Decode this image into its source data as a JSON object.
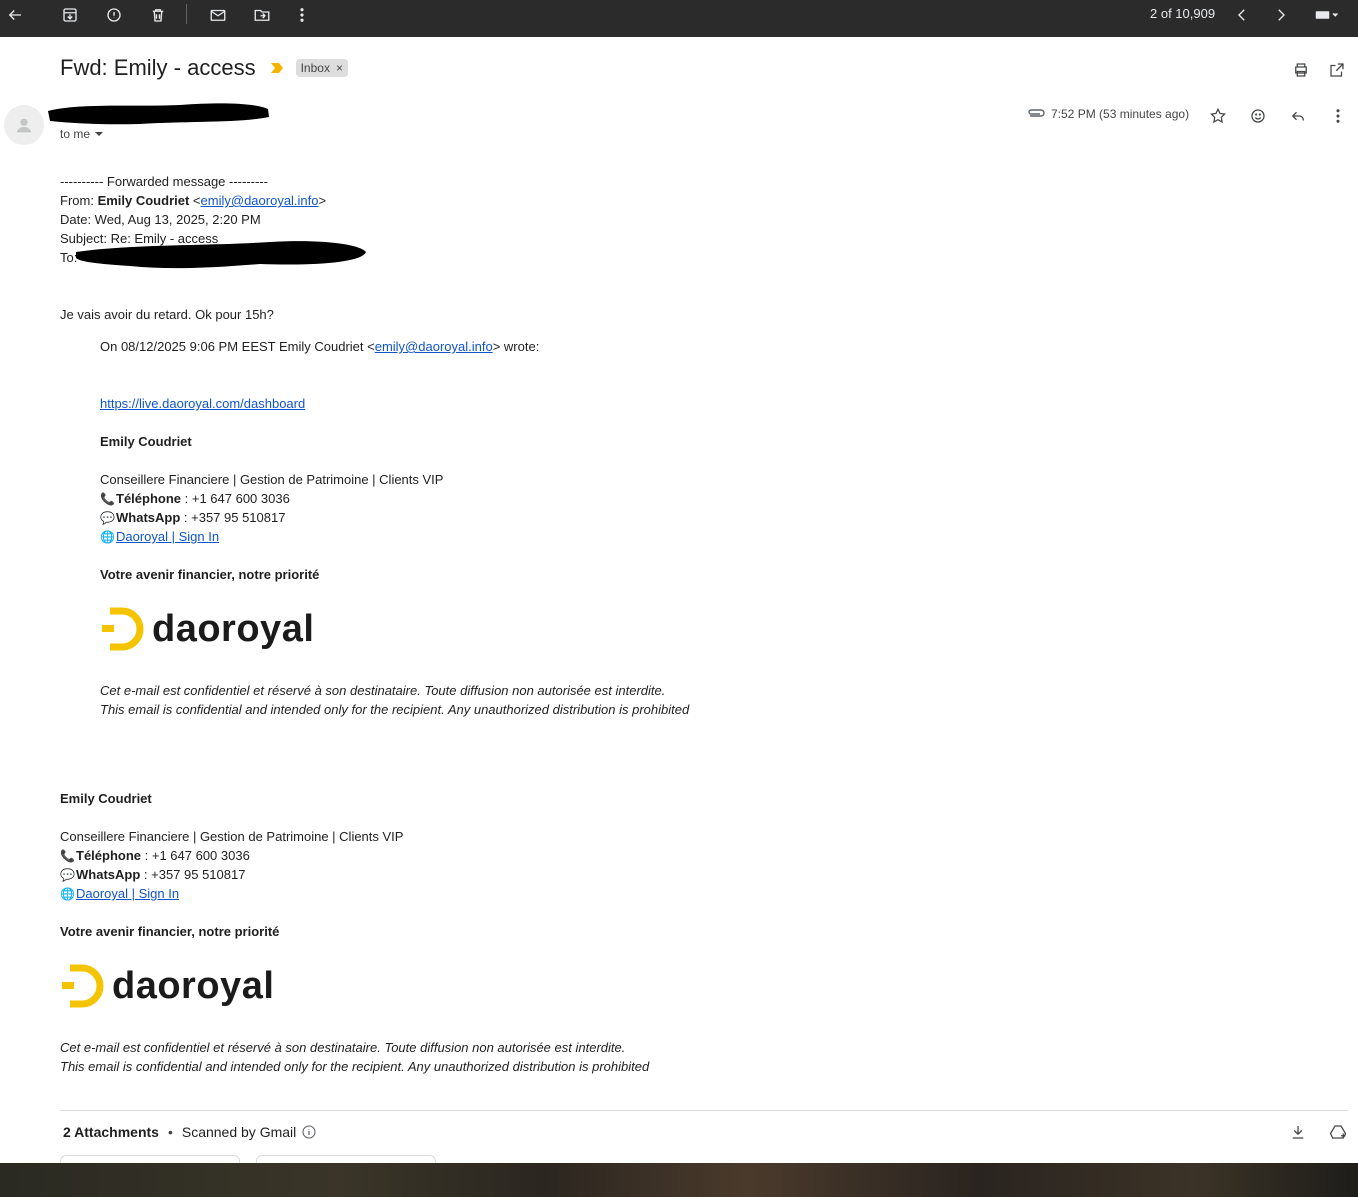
{
  "toolbar": {
    "page_count": "2 of 10,909"
  },
  "message": {
    "subject": "Fwd: Emily - access",
    "label": "Inbox",
    "to_me": "to me",
    "timestamp": "7:52 PM (53 minutes ago)"
  },
  "forward": {
    "divider": "---------- Forwarded message ---------",
    "from_prefix": "From: ",
    "from_name": "Emily Coudriet",
    "from_lt": " <",
    "from_email": "emily@daoroyal.info",
    "from_gt": ">",
    "date": "Date: Wed, Aug 13, 2025, 2:20 PM",
    "subject": "Subject: Re: Emily - access",
    "to_prefix": "To: "
  },
  "reply_text": "Je vais avoir du retard. Ok pour 15h?",
  "quoted": {
    "on_prefix": "On 08/12/2025 9:06 PM EEST Emily Coudriet <",
    "on_email": "emily@daoroyal.info",
    "on_suffix": "> wrote:",
    "link": "https://live.daoroyal.com/dashboard"
  },
  "signature": {
    "name": "Emily Coudriet",
    "title": "Conseillere Financiere | Gestion de Patrimoine |  Clients VIP",
    "phone_label": "Téléphone",
    "phone_value": " : +1 647 600 3036",
    "whatsapp_label": "WhatsApp",
    "whatsapp_value": " : +357 95 510817",
    "site_link": "Daoroyal | Sign In",
    "tagline": "Votre avenir financier, notre priorité",
    "logo_text": "daoroyal",
    "disclaimer_fr": "Cet e-mail est confidentiel et réservé à son destinataire. Toute diffusion non autorisée est interdite.",
    "disclaimer_en": "This email is confidential and intended only for the recipient. Any unauthorized distribution is prohibited"
  },
  "attachments": {
    "count_label": "2 Attachments",
    "dot": "•",
    "scanned": "Scanned by Gmail"
  },
  "colors": {
    "toolbar_bg": "#2b2b2b",
    "link": "#1155cc",
    "logo_yellow": "#f5c400",
    "label_bg": "#dddddd"
  }
}
